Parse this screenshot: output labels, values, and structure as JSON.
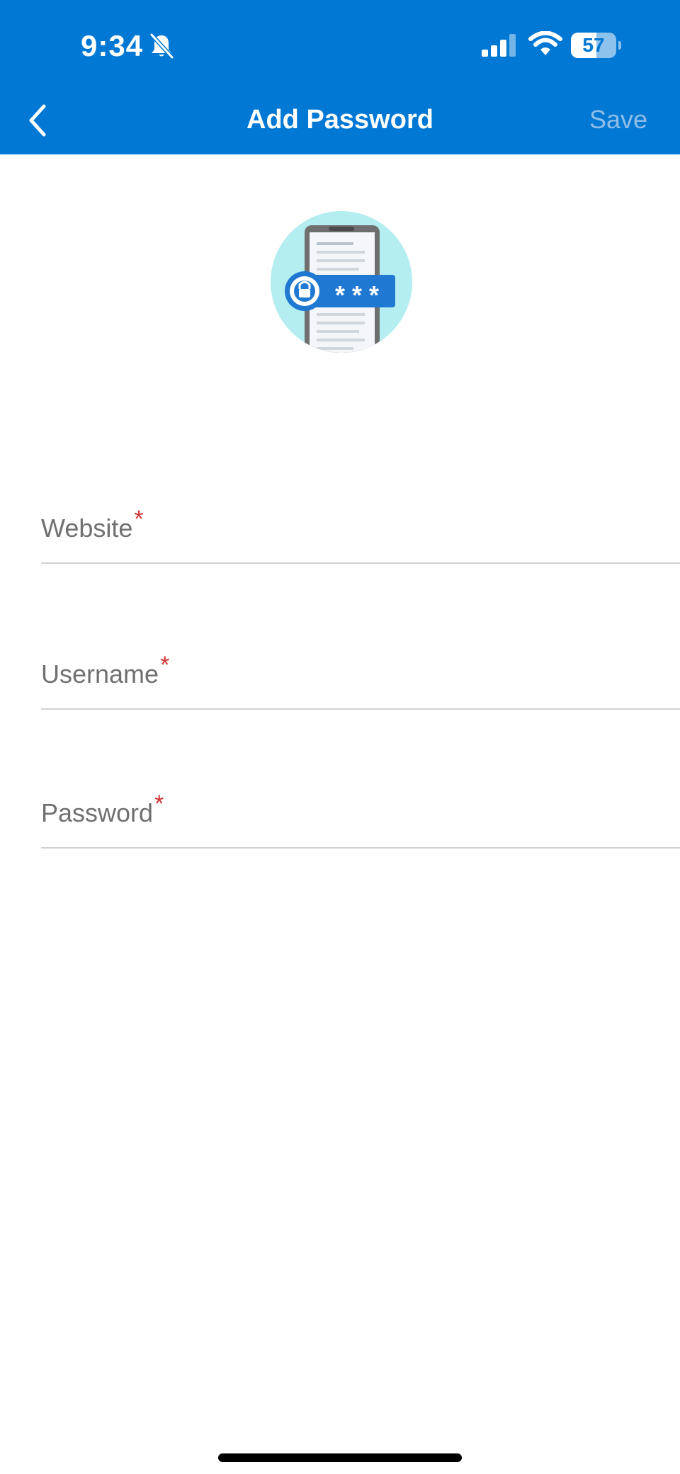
{
  "status_bar": {
    "time": "9:34",
    "battery": "57",
    "battery_level": 0.57,
    "icons": [
      "bell-slash-icon",
      "cellular-signal-icon",
      "wifi-icon",
      "battery-icon"
    ]
  },
  "header": {
    "title": "Add Password",
    "save_label": "Save",
    "back_icon": "chevron-left-icon",
    "background_color": "#0078d4",
    "save_disabled_color": "#8fbde6"
  },
  "illustration": {
    "icon": "phone-lock-password-illustration",
    "masked_text": "* * *"
  },
  "form": {
    "fields": [
      {
        "label": "Website",
        "required_marker": "*",
        "value": ""
      },
      {
        "label": "Username",
        "required_marker": "*",
        "value": ""
      },
      {
        "label": "Password",
        "required_marker": "*",
        "value": ""
      }
    ],
    "required_color": "#d13438"
  }
}
